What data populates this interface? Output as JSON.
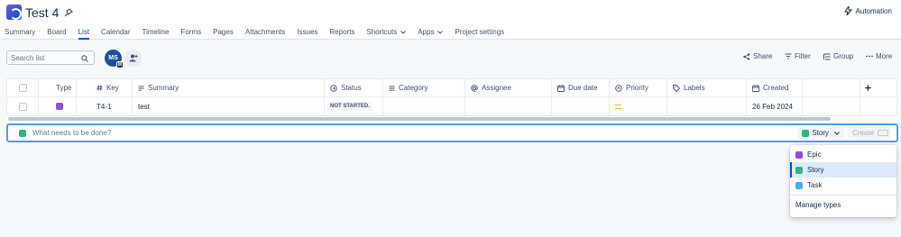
{
  "project": {
    "title": "Test 4"
  },
  "header": {
    "automation_label": "Automation"
  },
  "tabs": [
    {
      "label": "Summary"
    },
    {
      "label": "Board"
    },
    {
      "label": "List"
    },
    {
      "label": "Calendar"
    },
    {
      "label": "Timeline"
    },
    {
      "label": "Forms"
    },
    {
      "label": "Pages"
    },
    {
      "label": "Attachments"
    },
    {
      "label": "Issues"
    },
    {
      "label": "Reports"
    },
    {
      "label": "Shortcuts"
    },
    {
      "label": "Apps"
    },
    {
      "label": "Project settings"
    }
  ],
  "toolbar": {
    "search_placeholder": "Search list",
    "avatar_initials": "MS",
    "share_label": "Share",
    "filter_label": "Filter",
    "group_label": "Group",
    "more_label": "More"
  },
  "table": {
    "columns": [
      "Type",
      "Key",
      "Summary",
      "Status",
      "Category",
      "Assignee",
      "Due date",
      "Priority",
      "Labels",
      "Created"
    ],
    "rows": [
      {
        "type": "Epic",
        "key": "T4-1",
        "summary": "test",
        "status": "NOT STARTED.",
        "category": "",
        "assignee": "",
        "due_date": "",
        "priority": "Medium",
        "labels": "",
        "created": "26 Feb 2024"
      }
    ]
  },
  "create": {
    "placeholder": "What needs to be done?",
    "type_selected": "Story",
    "create_label": "Create"
  },
  "type_menu": {
    "items": [
      {
        "label": "Epic",
        "color": "#904ee2"
      },
      {
        "label": "Story",
        "color": "#36b37e"
      },
      {
        "label": "Task",
        "color": "#4bade8"
      }
    ],
    "manage_label": "Manage types"
  },
  "colors": {
    "accent": "#0052cc",
    "priority_medium": "#ffab00"
  }
}
